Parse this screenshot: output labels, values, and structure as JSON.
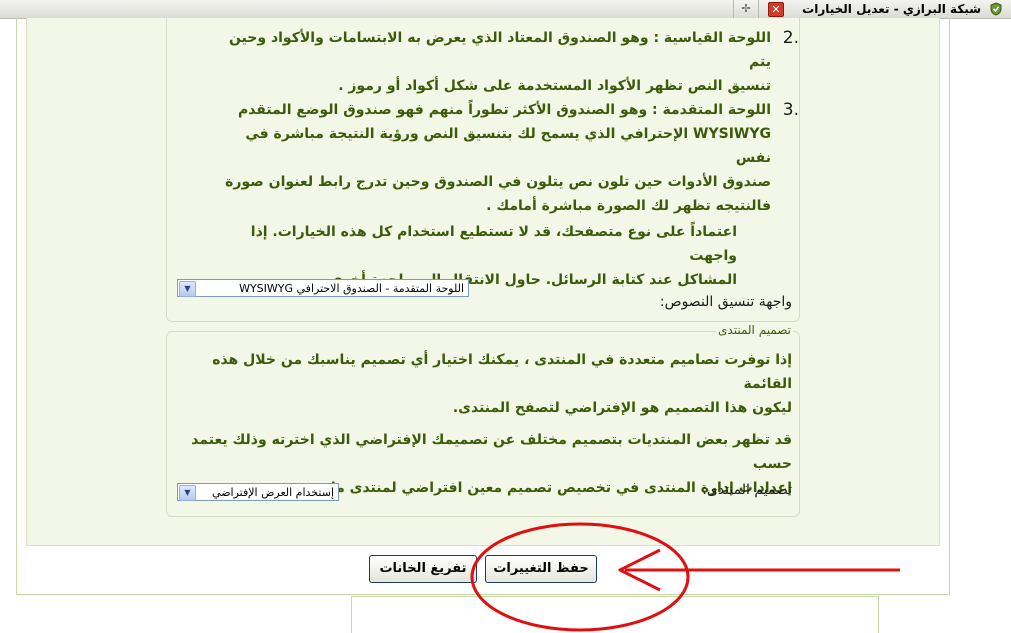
{
  "browser": {
    "tab_title": "شبكة البرازي - تعديل الخيارات",
    "close_glyph": "✕",
    "new_tab_glyph": "✢"
  },
  "editor_options": {
    "items": [
      {
        "number": ".2",
        "lines": [
          "اللوحة القياسية : وهو الصندوق المعتاد الذي يعرض به الابتسامات والأكواد وحين يتم",
          "تنسيق النص تظهر الأكواد المستخدمة على شكل أكواد أو رموز ."
        ]
      },
      {
        "number": ".3",
        "lines": [
          "اللوحة المتقدمة : وهو الصندوق الأكثر تطوراً منهم فهو صندوق الوضع المتقدم",
          "WYSIWYG الإحترافي الذي يسمح لك بتنسيق النص ورؤية النتيجة مباشرة في نفس",
          "صندوق الأدوات حين تلون نص يتلون في الصندوق وحين تدرج رابط لعنوان صورة",
          "فالنتيجه تظهر لك الصورة مباشرة أمامك ."
        ]
      }
    ],
    "compat_note": [
      "اعتماداً على نوع متصفحك، قد لا تستطيع استخدام كل هذه الخيارات. إذا واجهت",
      "المشاكل عند كتابة الرسائل. حاول الانتقال إلى واجهة أخرى."
    ],
    "editor_label": "واجهة تنسيق النصوص:",
    "editor_selected": "اللوحة المتقدمة - الصندوق الاحترافي WYSIWYG"
  },
  "forum_design": {
    "legend": "تصميم المنتدى",
    "para1": [
      "إذا توفرت تصاميم متعددة في المنتدى ، يمكنك اختيار أي تصميم يناسبك من خلال هذه القائمة",
      "ليكون هذا التصميم هو الإفتراضي لتصفح المنتدى."
    ],
    "para2": [
      "قد تظهر بعض المنتديات بتصميم مختلف عن تصميمك الإفتراضي الذي اخترته وذلك يعتمد حسب",
      "إعدادات إدارة المنتدى في تخصيص تصميم معين افتراضي لمنتدى ما."
    ],
    "design_label": "تصميم المنتدى:",
    "design_selected": "إستخدام العرض الإفتراضي"
  },
  "buttons": {
    "save": "حفظ التغييرات",
    "reset": "تفريغ الخانات"
  },
  "colors": {
    "panel_bg": "#f3f7e8",
    "text_green": "#3d5a0a",
    "annotation_red": "#e01010"
  }
}
